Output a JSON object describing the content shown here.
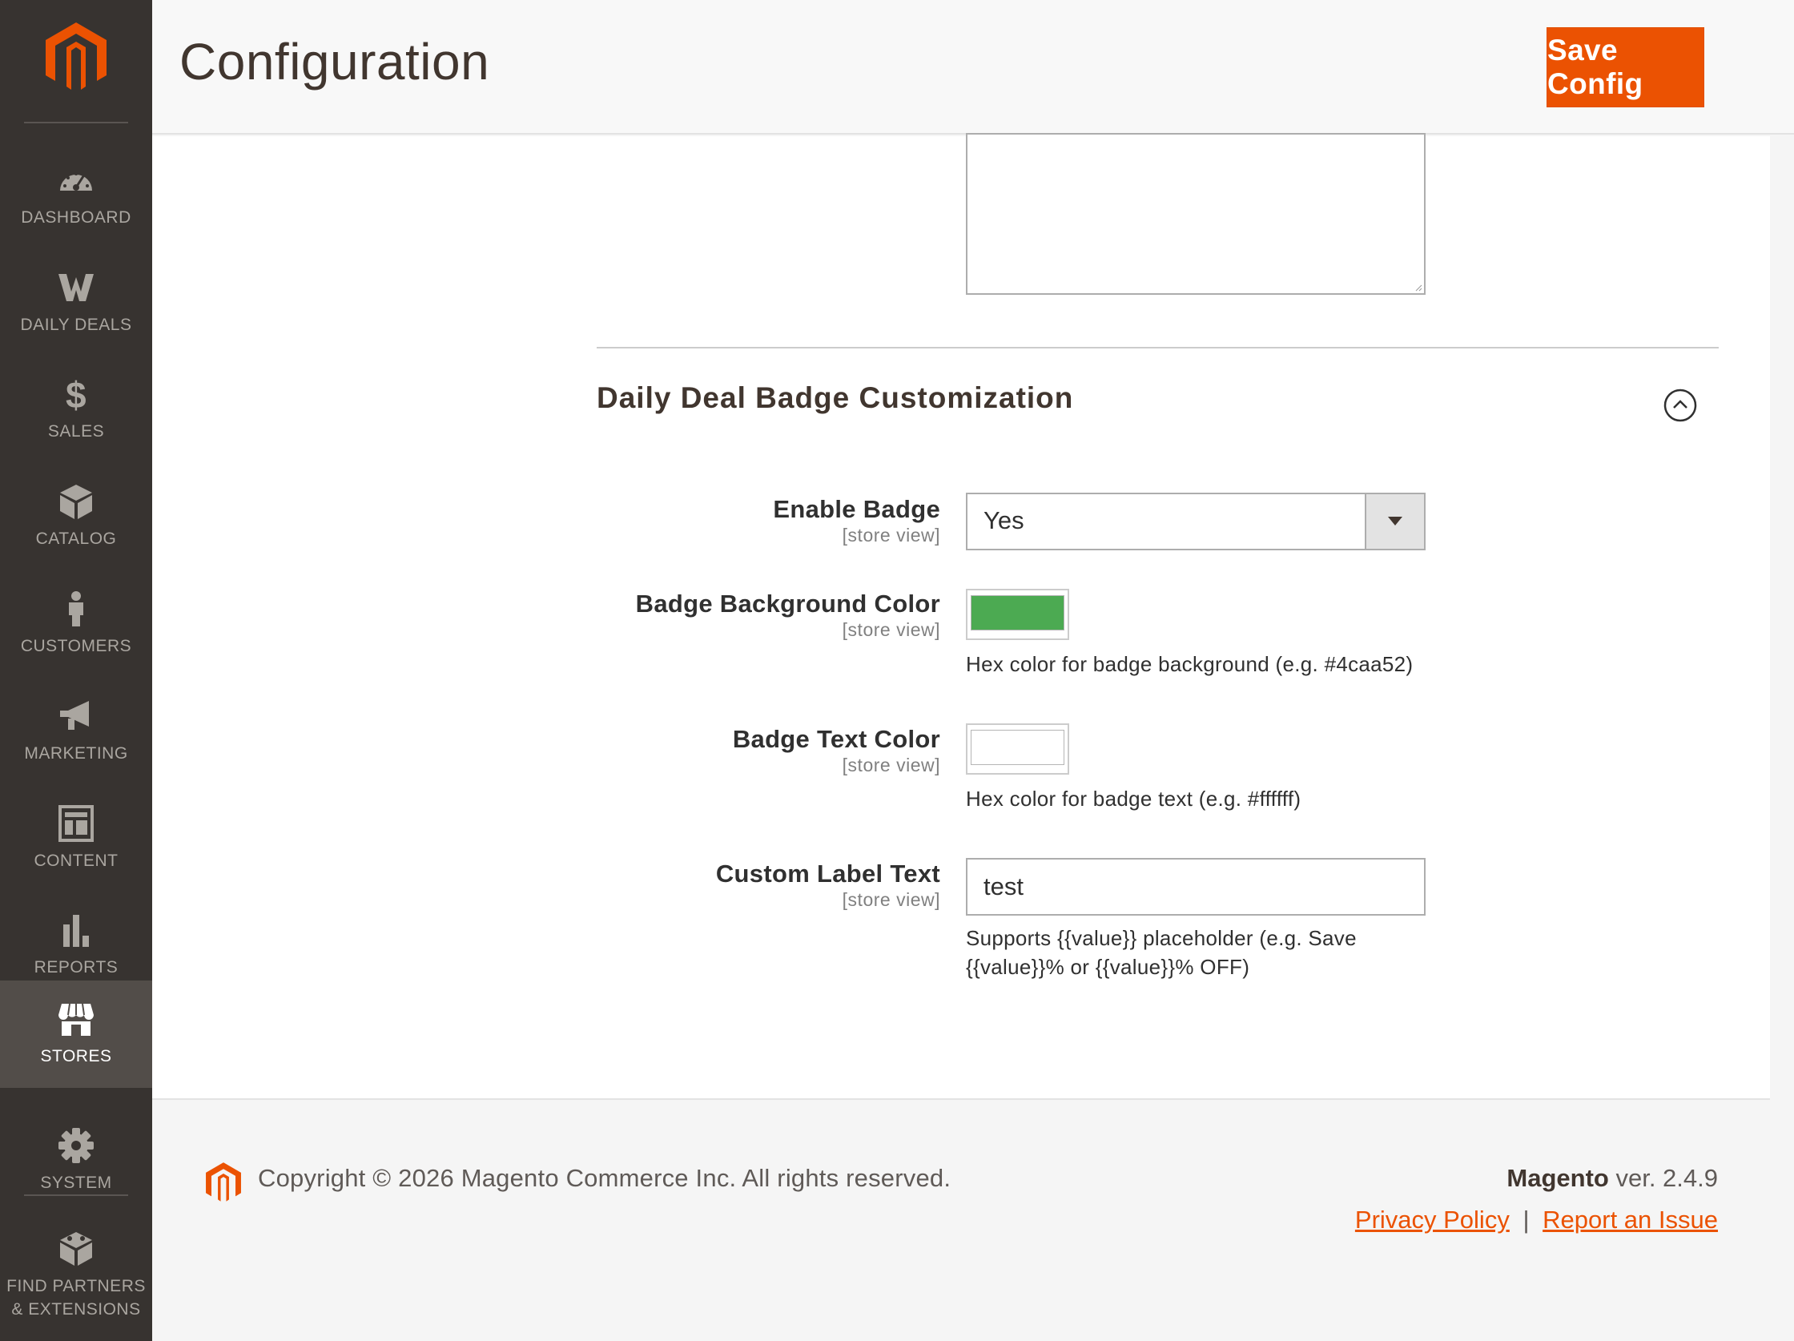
{
  "colors": {
    "sidebar_bg": "#373330",
    "sidebar_active_bg": "#524d49",
    "accent": "#eb5202",
    "badge_background_color": "#4caa52",
    "badge_text_color": "#ffffff"
  },
  "sidebar": {
    "items": [
      {
        "label": "DASHBOARD",
        "icon": "dashboard-icon"
      },
      {
        "label": "DAILY DEALS",
        "icon": "daily-deals-icon"
      },
      {
        "label": "SALES",
        "icon": "dollar-icon"
      },
      {
        "label": "CATALOG",
        "icon": "box-icon"
      },
      {
        "label": "CUSTOMERS",
        "icon": "person-icon"
      },
      {
        "label": "MARKETING",
        "icon": "megaphone-icon"
      },
      {
        "label": "CONTENT",
        "icon": "layout-icon"
      },
      {
        "label": "REPORTS",
        "icon": "bar-chart-icon"
      },
      {
        "label": "STORES",
        "icon": "storefront-icon"
      },
      {
        "label": "SYSTEM",
        "icon": "gear-icon"
      },
      {
        "label_line1": "FIND PARTNERS",
        "label_line2": "& EXTENSIONS",
        "icon": "blocks-icon"
      }
    ],
    "active": "STORES"
  },
  "header": {
    "title": "Configuration",
    "save_label": "Save Config"
  },
  "section": {
    "title": "Daily Deal Badge Customization"
  },
  "fields": {
    "enable_badge": {
      "label": "Enable Badge",
      "scope": "[store view]",
      "value": "Yes"
    },
    "badge_bg_color": {
      "label": "Badge Background Color",
      "scope": "[store view]",
      "hint": "Hex color for badge background (e.g. #4caa52)"
    },
    "badge_text_color": {
      "label": "Badge Text Color",
      "scope": "[store view]",
      "hint": "Hex color for badge text (e.g. #ffffff)"
    },
    "custom_label": {
      "label": "Custom Label Text",
      "scope": "[store view]",
      "value": "test",
      "hint_line1": "Supports {{value}} placeholder (e.g. Save",
      "hint_line2": "{{value}}% or {{value}}% OFF)"
    }
  },
  "footer": {
    "copyright": "Copyright © 2026 Magento Commerce Inc. All rights reserved.",
    "brand": "Magento",
    "version": " ver. 2.4.9",
    "privacy_link": "Privacy Policy",
    "separator": "|",
    "report_link": "Report an Issue"
  }
}
